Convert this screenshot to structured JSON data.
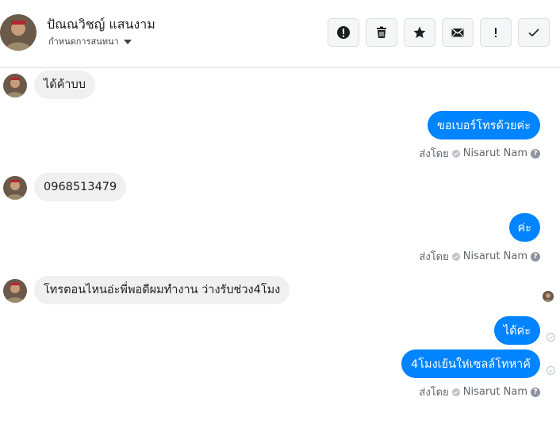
{
  "header": {
    "name": "ปัณณวิชญ์ แสนงาม",
    "subtitle": "กำหนดการสนทนา",
    "toolbar": [
      "alert-circle-icon",
      "trash-icon",
      "star-icon",
      "envelope-icon",
      "exclamation-icon",
      "check-icon"
    ]
  },
  "messages": {
    "in_1": "ได้ค้าบบ",
    "out_1": "ขอเบอร์โทรด้วยค่ะ",
    "in_2": "0968513479",
    "out_2": "ค่ะ",
    "in_3": "โทรตอนไหนอ่ะพี่พอดีผมทำงาน ว่างรับช่วง4โมง",
    "out_3": "ได้ค่ะ",
    "out_4": "4โมงเย้นให่เซลล์โทหาค้"
  },
  "sent_by": {
    "prefix": "ส่งโดย",
    "name": "Nisarut Nam"
  },
  "colors": {
    "bubble_out": "#0084ff",
    "bubble_in": "#f1f0f0"
  }
}
